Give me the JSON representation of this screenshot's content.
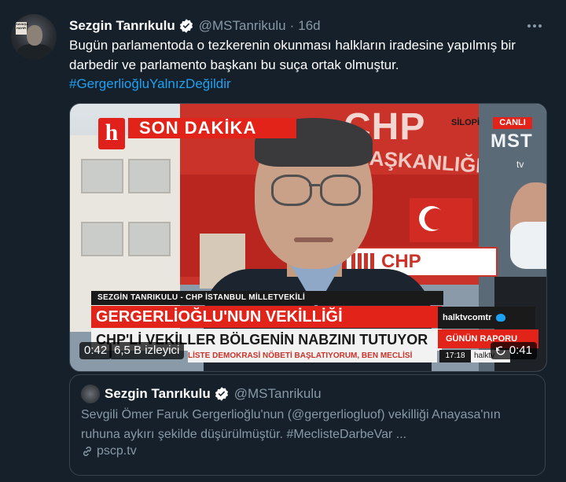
{
  "tweet": {
    "display_name": "Sezgin Tanrıkulu",
    "handle": "@MSTanrikulu",
    "separator": "·",
    "time": "16d",
    "text": "Bugün parlamentoda o tezkerenin okunması halkların iradesine yapılmış bir darbedir ve parlamento başkanı bu suça ortak olmuştur.",
    "hashtag": "#GergerlioğluYalnızDeğildir"
  },
  "avatar_sign": "SAVAŞA HAYIR",
  "video": {
    "broadcast": {
      "logo": "h",
      "breaking": "SON DAKİKA",
      "location": "SİLOPİ",
      "live": "CANLI",
      "station": "MST",
      "station_sub": "tv",
      "building_sign": "CHP",
      "building_text": "BAŞKANLIĞI",
      "entrance_sign": "CHP",
      "speaker_caption": "SEZGİN TANRIKULU - CHP İSTANBUL MİLLETVEKİLİ",
      "headline": "GERGERLİOĞLU'NUN VEKİLLİĞİ DÜŞÜRÜLDÜ",
      "subheadline": "CHP'Lİ VEKİLLER BÖLGENİN NABZINI TUTUYOR",
      "ticker": "LİSTE DEMOKRASİ NÖBETİ BAŞLATIYORUM, BEN MECLİSİ",
      "social_handle": "halktvcomtr",
      "program": "GÜNÜN RAPORU",
      "clock": "17:18",
      "channel_small": "halktv"
    },
    "elapsed": "0:42",
    "views": "6,5 B izleyici",
    "remaining": "0:41"
  },
  "quote": {
    "display_name": "Sezgin Tanrıkulu",
    "handle": "@MSTanrikulu",
    "text": "Sevgili Ömer Faruk Gergerlioğlu'nun (@gergerliogluof) vekilliği Anayasa'nın ruhuna aykırı şekilde düşürülmüştür. #MeclisteDarbeVar ...",
    "link": "pscp.tv"
  },
  "colors": {
    "background": "#15202b",
    "accent": "#1da1f2",
    "secondary_text": "#8899a6",
    "border": "#38444d"
  }
}
